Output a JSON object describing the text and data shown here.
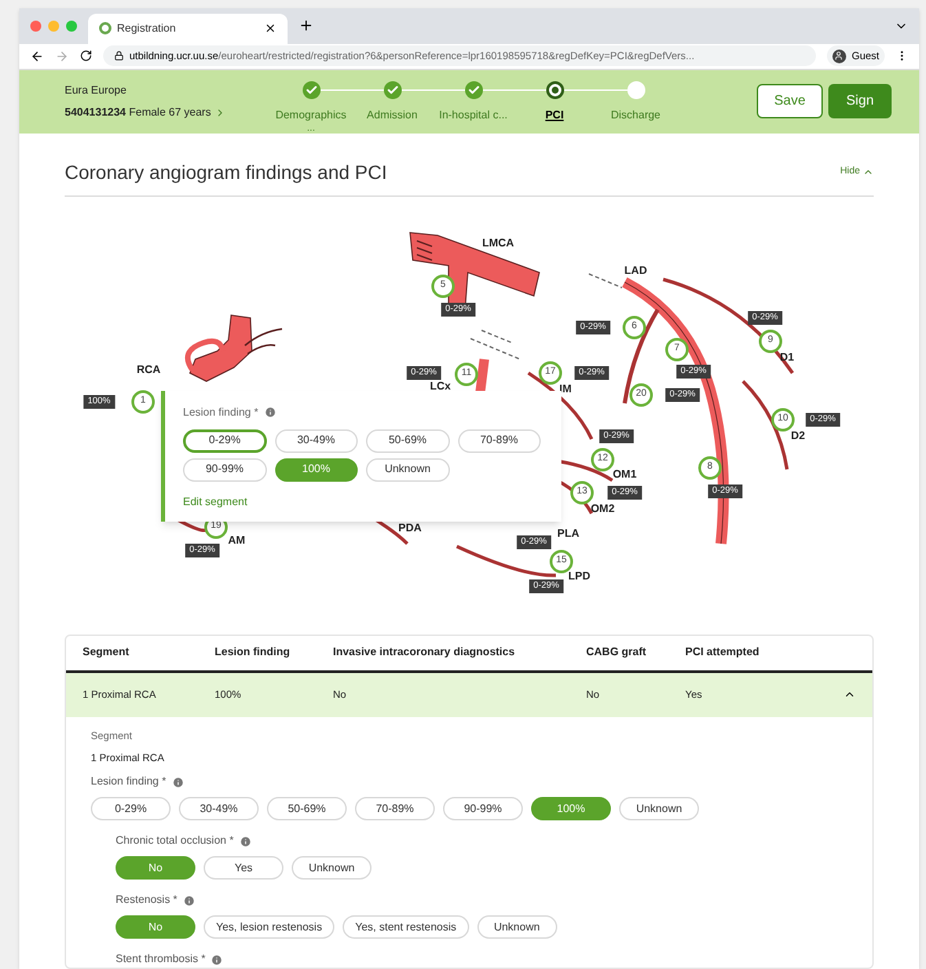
{
  "browser": {
    "tab_title": "Registration",
    "url_host": "utbildning.ucr.uu.se",
    "url_path": "/euroheart/restricted/registration?6&personReference=lpr160198595718&regDefKey=PCI&regDefVers...",
    "profile": "Guest"
  },
  "header": {
    "patient_name": "Eura Europe",
    "patient_id": "5404131234",
    "patient_info": "Female 67 years",
    "steps": [
      {
        "label": "Demographics",
        "kind": "done",
        "note": "..."
      },
      {
        "label": "Admission",
        "kind": "done"
      },
      {
        "label": "In-hospital c...",
        "kind": "done"
      },
      {
        "label": "PCI",
        "kind": "current"
      },
      {
        "label": "Discharge",
        "kind": "todo"
      }
    ],
    "buttons": [
      {
        "label": "Save",
        "kind": "secondary"
      },
      {
        "label": "Sign",
        "kind": "primary"
      }
    ]
  },
  "section": {
    "title": "Coronary angiogram findings and PCI",
    "toggle": "Hide"
  },
  "diagram": {
    "vessel_labels": [
      "RCA",
      "LMCA",
      "LAD",
      "D1",
      "D2",
      "LCx",
      "IM",
      "OM1",
      "OM2",
      "PLA",
      "LPD",
      "AM",
      "PDA"
    ],
    "segments": [
      {
        "number": "1",
        "finding": "100%"
      },
      {
        "number": "5",
        "finding": "0-29%"
      },
      {
        "number": "6",
        "finding": "0-29%"
      },
      {
        "number": "7",
        "finding": "0-29%"
      },
      {
        "number": "9",
        "finding": "0-29%"
      },
      {
        "number": "10",
        "finding": "0-29%"
      },
      {
        "number": "11",
        "finding": "0-29%"
      },
      {
        "number": "17",
        "finding": "0-29%"
      },
      {
        "number": "20",
        "finding": "0-29%"
      },
      {
        "number": "12",
        "finding": "0-29%"
      },
      {
        "number": "13",
        "finding": "0-29%"
      },
      {
        "number": "8",
        "finding": "0-29%"
      },
      {
        "number": "19",
        "finding": "0-29%"
      },
      {
        "finding": "0-29%"
      },
      {
        "number": "15",
        "finding": "0-29%"
      }
    ],
    "popup": {
      "label": "Lesion finding *",
      "options": [
        {
          "label": "0-29%",
          "selected": false,
          "focused": true
        },
        {
          "label": "30-49%",
          "selected": false,
          "focused": false
        },
        {
          "label": "50-69%",
          "selected": false,
          "focused": false
        },
        {
          "label": "70-89%",
          "selected": false,
          "focused": false
        },
        {
          "label": "90-99%",
          "selected": false,
          "focused": false
        },
        {
          "label": "100%",
          "selected": true,
          "focused": false
        },
        {
          "label": "Unknown",
          "selected": false,
          "focused": false
        }
      ],
      "link": "Edit segment"
    }
  },
  "table": {
    "columns": [
      "Segment",
      "Lesion finding",
      "Invasive intracoronary diagnostics",
      "CABG graft",
      "PCI attempted"
    ],
    "rows": [
      {
        "cells": [
          "1 Proximal RCA",
          "100%",
          "No",
          "No",
          "Yes"
        ],
        "expanded": true
      }
    ]
  },
  "detail": {
    "segment_label": "Segment",
    "segment_value": "1 Proximal RCA",
    "groups": [
      {
        "label": "Lesion finding *",
        "options": [
          {
            "label": "0-29%",
            "selected": false
          },
          {
            "label": "30-49%",
            "selected": false
          },
          {
            "label": "50-69%",
            "selected": false
          },
          {
            "label": "70-89%",
            "selected": false
          },
          {
            "label": "90-99%",
            "selected": false
          },
          {
            "label": "100%",
            "selected": true
          },
          {
            "label": "Unknown",
            "selected": false
          }
        ],
        "children": [
          {
            "label": "Chronic total occlusion *",
            "options": [
              {
                "label": "No",
                "selected": true
              },
              {
                "label": "Yes",
                "selected": false
              },
              {
                "label": "Unknown",
                "selected": false
              }
            ]
          },
          {
            "label": "Restenosis *",
            "options": [
              {
                "label": "No",
                "selected": true
              },
              {
                "label": "Yes, lesion restenosis",
                "selected": false
              },
              {
                "label": "Yes, stent restenosis",
                "selected": false
              },
              {
                "label": "Unknown",
                "selected": false
              }
            ]
          },
          {
            "label": "Stent thrombosis *"
          }
        ]
      }
    ]
  }
}
